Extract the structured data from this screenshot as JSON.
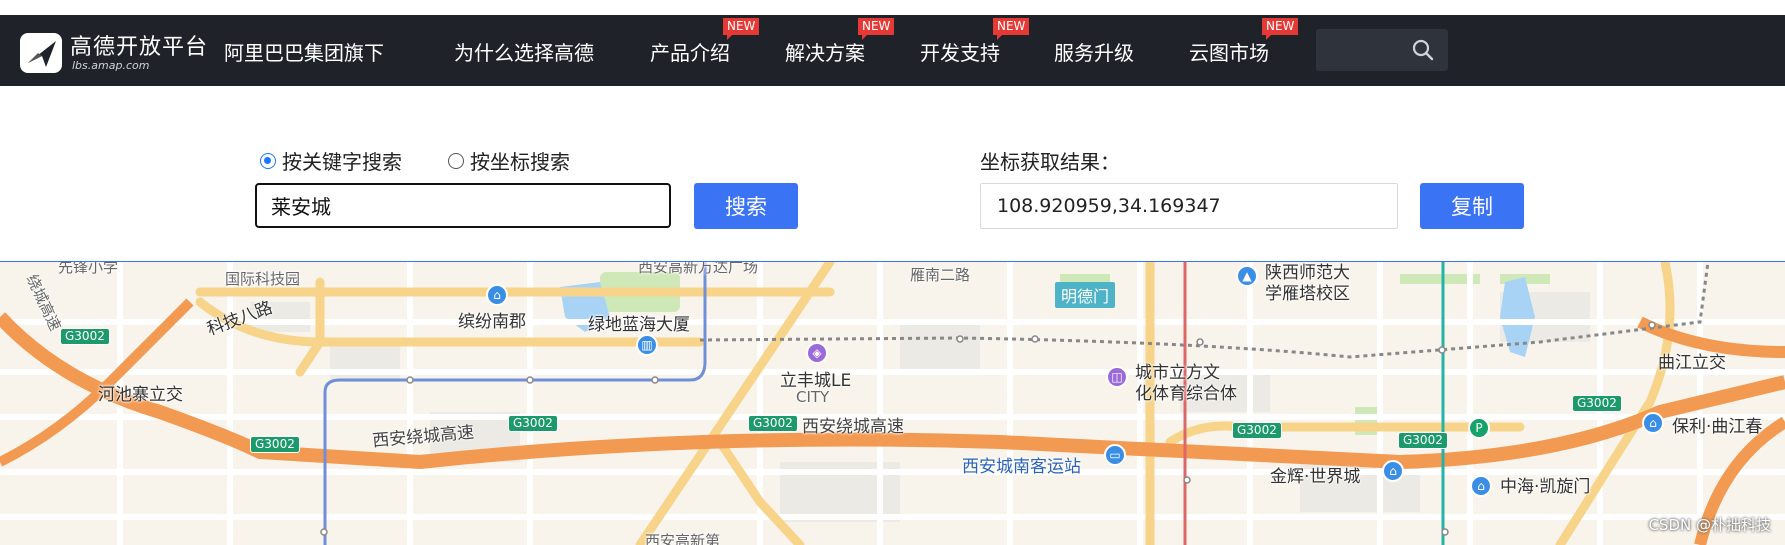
{
  "navbar": {
    "logo_title": "高德开放平台",
    "logo_sub": "lbs.amap.com",
    "group_text": "阿里巴巴集团旗下",
    "items": [
      {
        "label": "为什么选择高德",
        "badge": ""
      },
      {
        "label": "产品介绍",
        "badge": "NEW"
      },
      {
        "label": "解决方案",
        "badge": "NEW"
      },
      {
        "label": "开发支持",
        "badge": "NEW"
      },
      {
        "label": "服务升级",
        "badge": ""
      },
      {
        "label": "云图市场",
        "badge": "NEW"
      }
    ]
  },
  "search": {
    "mode_keyword_label": "按关键字搜索",
    "mode_coord_label": "按坐标搜索",
    "selected_mode": "keyword",
    "keyword_value": "莱安城",
    "search_button": "搜索",
    "result_label": "坐标获取结果：",
    "result_value": "108.920959,34.169347",
    "copy_button": "复制"
  },
  "map": {
    "labels": {
      "xianfeng": "先锋小学",
      "guoji": "国际科技园",
      "xiangongyuan": "西安高新万达广场",
      "yannan": "雁南二路",
      "shida": "陕西师范大",
      "shida2": "学雁塔校区",
      "keji8": "科技八路",
      "binfen": "缤纷南郡",
      "lvdi": "绿地蓝海大厦",
      "mingdemen": "明德门",
      "hechi": "河池寨立交",
      "lifeng1": "立丰城LE",
      "lifeng2": "CITY",
      "chengshi1": "城市立方文",
      "chengshi2": "化体育综合体",
      "qujiang": "曲江立交",
      "raocheng1": "西安绕城高速",
      "raocheng2": "西安绕城高速",
      "baoli": "保利·曲江春",
      "keyun": "西安城南客运站",
      "jinhui": "金辉·世界城",
      "zhonghai": "中海·凯旋门",
      "gaoxin_bottom": "西安高新第",
      "raocheng_left": "绕城高速"
    },
    "shields": [
      "G3002",
      "G3002",
      "G3002",
      "G3002",
      "G3002",
      "G3002",
      "G3002"
    ],
    "watermark": "CSDN @朴拙科技"
  }
}
